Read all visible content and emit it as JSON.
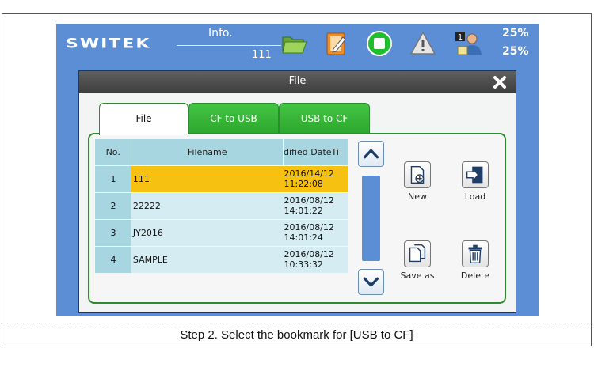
{
  "topbar": {
    "logo": "SWITEK",
    "info_label": "Info.",
    "info_value": "111",
    "percent_top": "25%",
    "percent_bottom": "25%",
    "icons": [
      "folder-icon",
      "edit-icon",
      "stop-icon",
      "warning-icon",
      "user-icon"
    ]
  },
  "dialog": {
    "title": "File",
    "tabs": [
      {
        "label": "File",
        "active": true
      },
      {
        "label": "CF to USB",
        "active": false
      },
      {
        "label": "USB to CF",
        "active": false
      }
    ],
    "table": {
      "headers": [
        "No.",
        "Filename",
        "dified DateTi"
      ],
      "rows": [
        {
          "no": "1",
          "filename": "111",
          "date": "2016/14/12",
          "time": "11:22:08",
          "selected": true
        },
        {
          "no": "2",
          "filename": "22222",
          "date": "2016/08/12",
          "time": "14:01:22",
          "selected": false
        },
        {
          "no": "3",
          "filename": "JY2016",
          "date": "2016/08/12",
          "time": "14:01:24",
          "selected": false
        },
        {
          "no": "4",
          "filename": "SAMPLE",
          "date": "2016/08/12",
          "time": "10:33:32",
          "selected": false
        }
      ]
    },
    "actions": {
      "new": "New",
      "load": "Load",
      "save_as": "Save as",
      "delete": "Delete"
    }
  },
  "caption": "Step 2. Select the bookmark for [USB to CF]",
  "colors": {
    "screen_bg": "#5b8ed4",
    "tab_green": "#3cb83c",
    "selected_row": "#f7c112",
    "table_header": "#a7d6e1"
  }
}
